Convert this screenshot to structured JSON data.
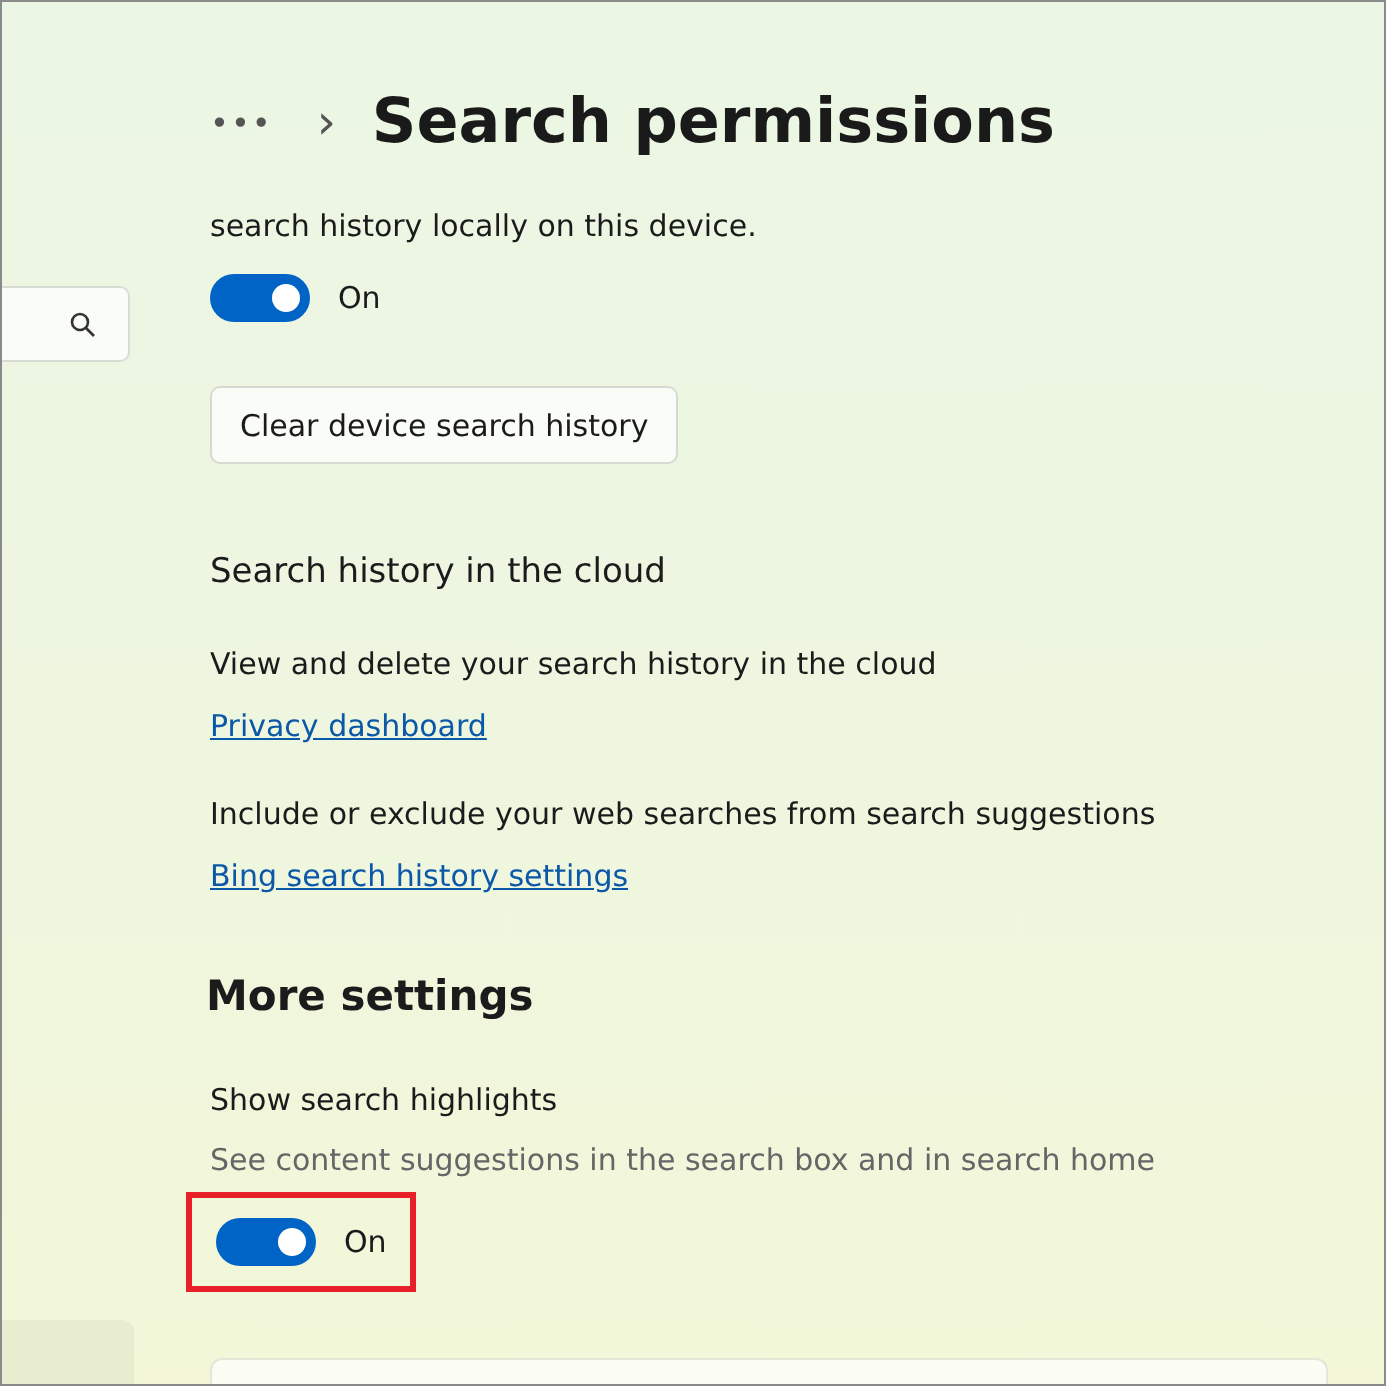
{
  "breadcrumb": {
    "more": "•••",
    "separator": "›",
    "title": "Search permissions"
  },
  "sections": [
    {
      "kind": "toggle-group",
      "description": "search history locally on this device.",
      "toggle": {
        "on": true,
        "label": "On",
        "highlighted": false
      },
      "button": "Clear device search history"
    },
    {
      "kind": "links",
      "heading": "Search history in the cloud",
      "items": [
        {
          "text": "View and delete your search history in the cloud",
          "link": "Privacy dashboard"
        },
        {
          "text": "Include or exclude your web searches from search suggestions",
          "link": "Bing search history settings"
        }
      ]
    },
    {
      "kind": "settings",
      "heading": "More settings",
      "title": "Show search highlights",
      "description": "See content suggestions in the search box and in search home",
      "toggle": {
        "on": true,
        "label": "On",
        "highlighted": true
      }
    }
  ]
}
